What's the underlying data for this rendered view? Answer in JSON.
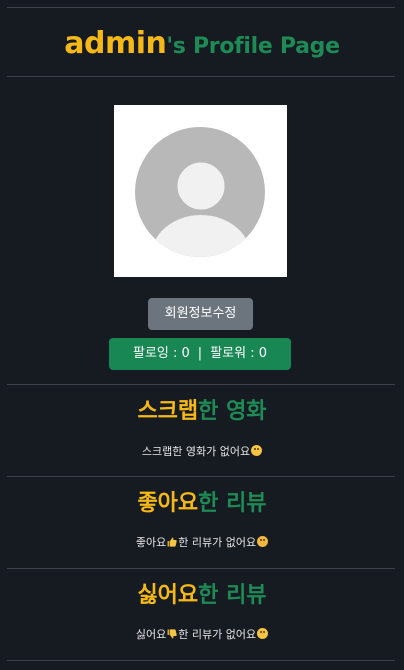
{
  "header": {
    "username": "admin",
    "title_suffix": "'s Profile Page"
  },
  "profile": {
    "avatar": "default-user-avatar",
    "edit_button_label": "회원정보수정",
    "following_label": "팔로잉 : 0",
    "separator": "|",
    "followers_label": "팔로워 : 0"
  },
  "sections": [
    {
      "keyword": "스크랩",
      "tail": "한 영화",
      "empty_text": "스크랩한 영화가 없어요",
      "emoji": "smile-emoji"
    },
    {
      "keyword": "좋아요",
      "tail": "한 리뷰",
      "empty_prefix": "좋아요",
      "empty_suffix": "한 리뷰가 없어요",
      "inline_icon": "thumbs-up-icon",
      "emoji": "sad-emoji"
    },
    {
      "keyword": "싫어요",
      "tail": "한 리뷰",
      "empty_prefix": "싫어요",
      "empty_suffix": "한 리뷰가 없어요",
      "inline_icon": "thumbs-down-icon",
      "emoji": "blush-emoji"
    }
  ],
  "colors": {
    "background": "#161a21",
    "accent_yellow": "#f5b816",
    "accent_green": "#1e8a55",
    "follow_bar": "#198754",
    "edit_button": "#6c757d"
  }
}
